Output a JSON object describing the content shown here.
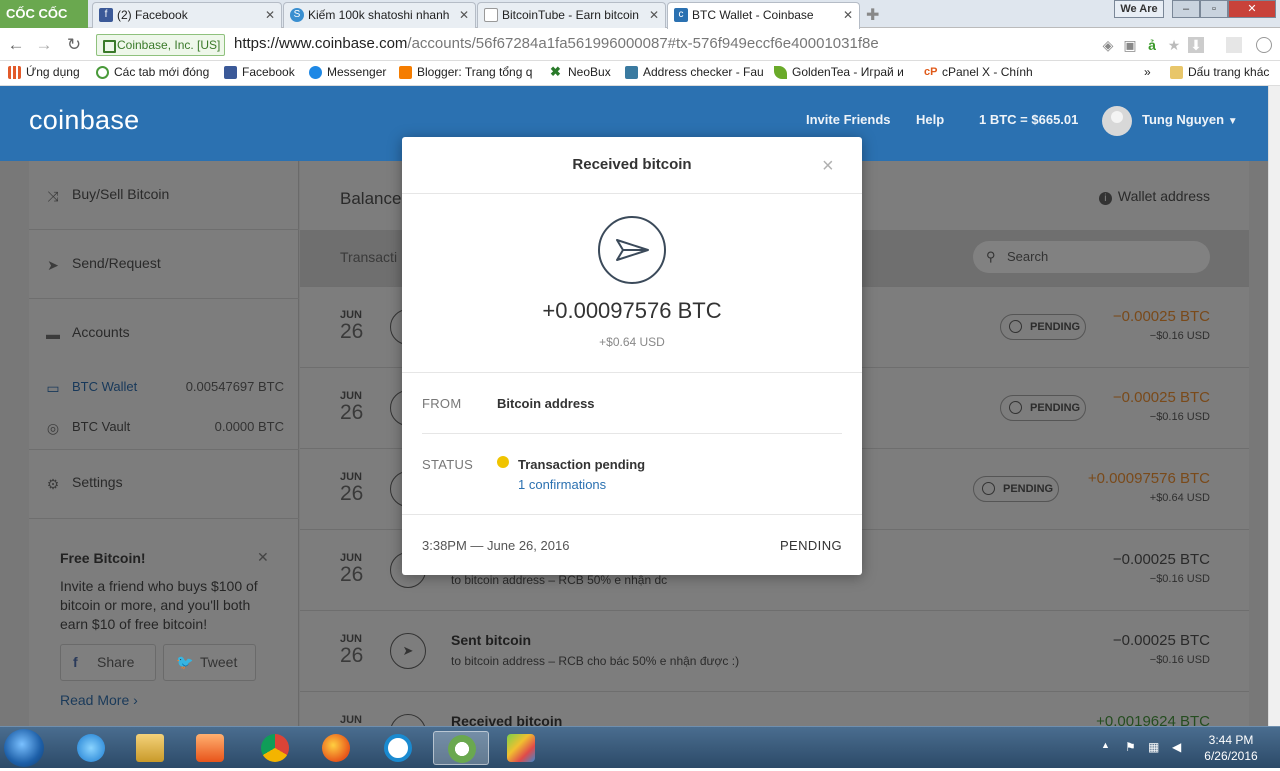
{
  "browser": {
    "brand": "CỐC CỐC",
    "tabs": [
      {
        "label": "(2) Facebook",
        "icon": "facebook-icon"
      },
      {
        "label": "Kiếm 100k shatoshi nhanh",
        "icon": "satoshi-icon"
      },
      {
        "label": "BitcoinTube - Earn bitcoin",
        "icon": "page-icon"
      },
      {
        "label": "BTC Wallet - Coinbase",
        "icon": "coinbase-icon"
      }
    ],
    "window_label": "We Are",
    "secure_label": "Coinbase, Inc. [US]",
    "url_host": "https://www.coinbase.com",
    "url_path": "/accounts/56f67284a1fa561996000087#tx-576f949eccf6e40001031f8e",
    "bookmarks": [
      "Ứng dụng",
      "Các tab mới đóng",
      "Facebook",
      "Messenger",
      "Blogger: Trang tổng q",
      "NeoBux",
      "Address checker - Fau",
      "GoldenTea - Играй и",
      "cPanel X - Chính"
    ],
    "bookmarks_more": "»",
    "other_bookmarks": "Dấu trang khác"
  },
  "header": {
    "logo": "coinbase",
    "invite": "Invite Friends",
    "help": "Help",
    "price": "1 BTC = $665.01",
    "user": "Tung Nguyen"
  },
  "sidebar": {
    "buy_sell": "Buy/Sell Bitcoin",
    "send_request": "Send/Request",
    "accounts": "Accounts",
    "btc_wallet": "BTC Wallet",
    "btc_wallet_balance": "0.00547697 BTC",
    "btc_vault": "BTC Vault",
    "btc_vault_balance": "0.0000 BTC",
    "settings": "Settings",
    "promo_title": "Free Bitcoin!",
    "promo_text": "Invite a friend who buys $100 of bitcoin or more, and you'll both earn $10 of free bitcoin!",
    "share": "Share",
    "tweet": "Tweet",
    "read_more": "Read More ›"
  },
  "main": {
    "balance_label": "Balance",
    "wallet_address": "Wallet address",
    "transactions_label": "Transacti",
    "search_placeholder": "Search",
    "rows": [
      {
        "month": "JUN",
        "day": "26",
        "title": "",
        "sub": "",
        "pending": "PENDING",
        "amount": "−0.00025 BTC",
        "usd": "−$0.16 USD",
        "tone": "orange"
      },
      {
        "month": "JUN",
        "day": "26",
        "title": "",
        "sub": "",
        "pending": "PENDING",
        "amount": "−0.00025 BTC",
        "usd": "−$0.16 USD",
        "tone": "orange"
      },
      {
        "month": "JUN",
        "day": "26",
        "title": "",
        "sub": "",
        "pending": "PENDING",
        "amount": "+0.00097576 BTC",
        "usd": "+$0.64 USD",
        "tone": "orange"
      },
      {
        "month": "JUN",
        "day": "26",
        "title": "",
        "sub": "to bitcoin address – RCB 50% e nhận dc",
        "pending": "",
        "amount": "−0.00025 BTC",
        "usd": "−$0.16 USD",
        "tone": "dark"
      },
      {
        "month": "JUN",
        "day": "26",
        "title": "Sent bitcoin",
        "sub": "to bitcoin address – RCB cho bác 50% e nhận được :)",
        "pending": "",
        "amount": "−0.00025 BTC",
        "usd": "−$0.16 USD",
        "tone": "dark"
      },
      {
        "month": "JUN",
        "day": "",
        "title": "Received bitcoin",
        "sub": "",
        "pending": "",
        "amount": "+0.0019624 BTC",
        "usd": "",
        "tone": "green"
      }
    ]
  },
  "modal": {
    "title": "Received bitcoin",
    "close": "×",
    "amount": "+0.00097576 BTC",
    "amount_usd": "+$0.64 USD",
    "from_label": "FROM",
    "from_value": "Bitcoin address",
    "status_label": "STATUS",
    "status_value": "Transaction pending",
    "confirmations": "1 confirmations",
    "time": "3:38PM — June 26, 2016",
    "footer_status": "PENDING"
  },
  "taskbar": {
    "time": "3:44 PM",
    "date": "6/26/2016"
  }
}
